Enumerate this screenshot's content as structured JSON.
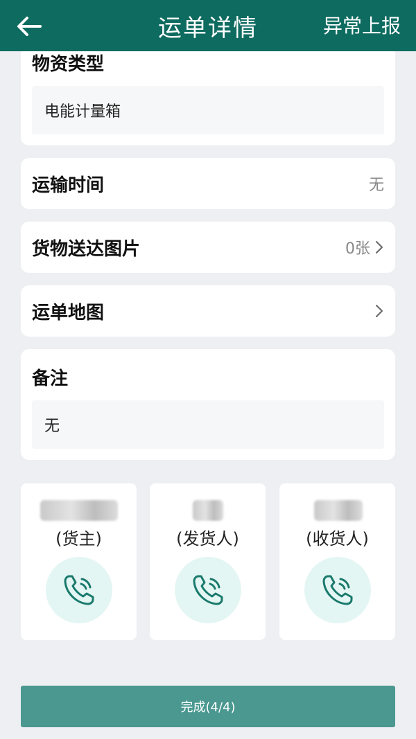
{
  "header": {
    "title": "运单详情",
    "report_label": "异常上报"
  },
  "material": {
    "title": "物资类型",
    "value": "电能计量箱"
  },
  "transport_time": {
    "title": "运输时间",
    "value": "无"
  },
  "delivery_photos": {
    "title": "货物送达图片",
    "value": "0张"
  },
  "waybill_map": {
    "title": "运单地图"
  },
  "remark": {
    "title": "备注",
    "value": "无"
  },
  "contacts": [
    {
      "role": "(货主)"
    },
    {
      "role": "(发货人)"
    },
    {
      "role": "(收货人)"
    }
  ],
  "complete_button": {
    "label": "完成(4/4)"
  },
  "colors": {
    "header_bg": "#0e6b60",
    "accent": "#1a7a6d",
    "phone_bg": "#e4f6f3",
    "button_bg": "#4a9890",
    "page_bg": "#eeeff3"
  }
}
